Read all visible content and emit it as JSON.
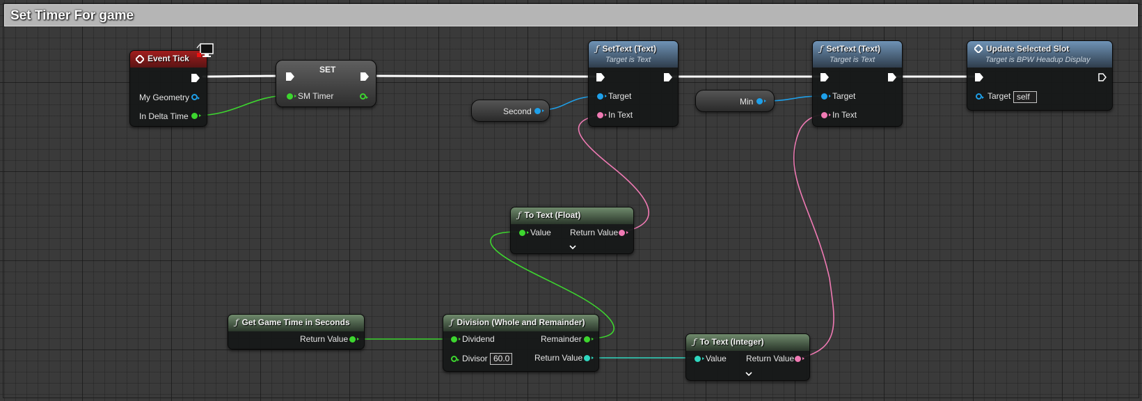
{
  "comment": {
    "title": "Set Timer For game"
  },
  "nodes": {
    "event_tick": {
      "title": "Event Tick",
      "pins": {
        "my_geometry": "My Geometry",
        "in_delta_time": "In Delta Time"
      }
    },
    "set": {
      "title": "SET",
      "pins": {
        "sm_timer": "SM Timer"
      }
    },
    "second": {
      "label": "Second"
    },
    "settext_1": {
      "title": "SetText (Text)",
      "subtitle": "Target is Text",
      "pins": {
        "target": "Target",
        "in_text": "In Text"
      }
    },
    "min": {
      "label": "Min"
    },
    "settext_2": {
      "title": "SetText (Text)",
      "subtitle": "Target is Text",
      "pins": {
        "target": "Target",
        "in_text": "In Text"
      }
    },
    "update_slot": {
      "title": "Update Selected Slot",
      "subtitle": "Target is BPW Headup Display",
      "pins": {
        "target": "Target",
        "target_value": "self"
      }
    },
    "to_text_float": {
      "title": "To Text (Float)",
      "pins": {
        "value": "Value",
        "return_value": "Return Value"
      }
    },
    "get_game_time": {
      "title": "Get Game Time in Seconds",
      "pins": {
        "return_value": "Return Value"
      }
    },
    "division": {
      "title": "Division (Whole and Remainder)",
      "pins": {
        "dividend": "Dividend",
        "remainder": "Remainder",
        "divisor": "Divisor",
        "divisor_value": "60.0",
        "return_value": "Return Value"
      }
    },
    "to_text_int": {
      "title": "To Text (Integer)",
      "pins": {
        "value": "Value",
        "return_value": "Return Value"
      }
    }
  },
  "pin_colors": {
    "exec": "#ffffff",
    "float": "#3dd62f",
    "object": "#1ea0ea",
    "text": "#f07ab4",
    "integer": "#2fd8c0",
    "event_header": "#a11d1d",
    "pure_header": "#6f8a6c",
    "function_header": "#6f93b6"
  },
  "icons": [
    "event-diamond-icon",
    "monitor-icon",
    "function-f-icon",
    "exec-arrow-icon",
    "chevron-down-icon"
  ]
}
